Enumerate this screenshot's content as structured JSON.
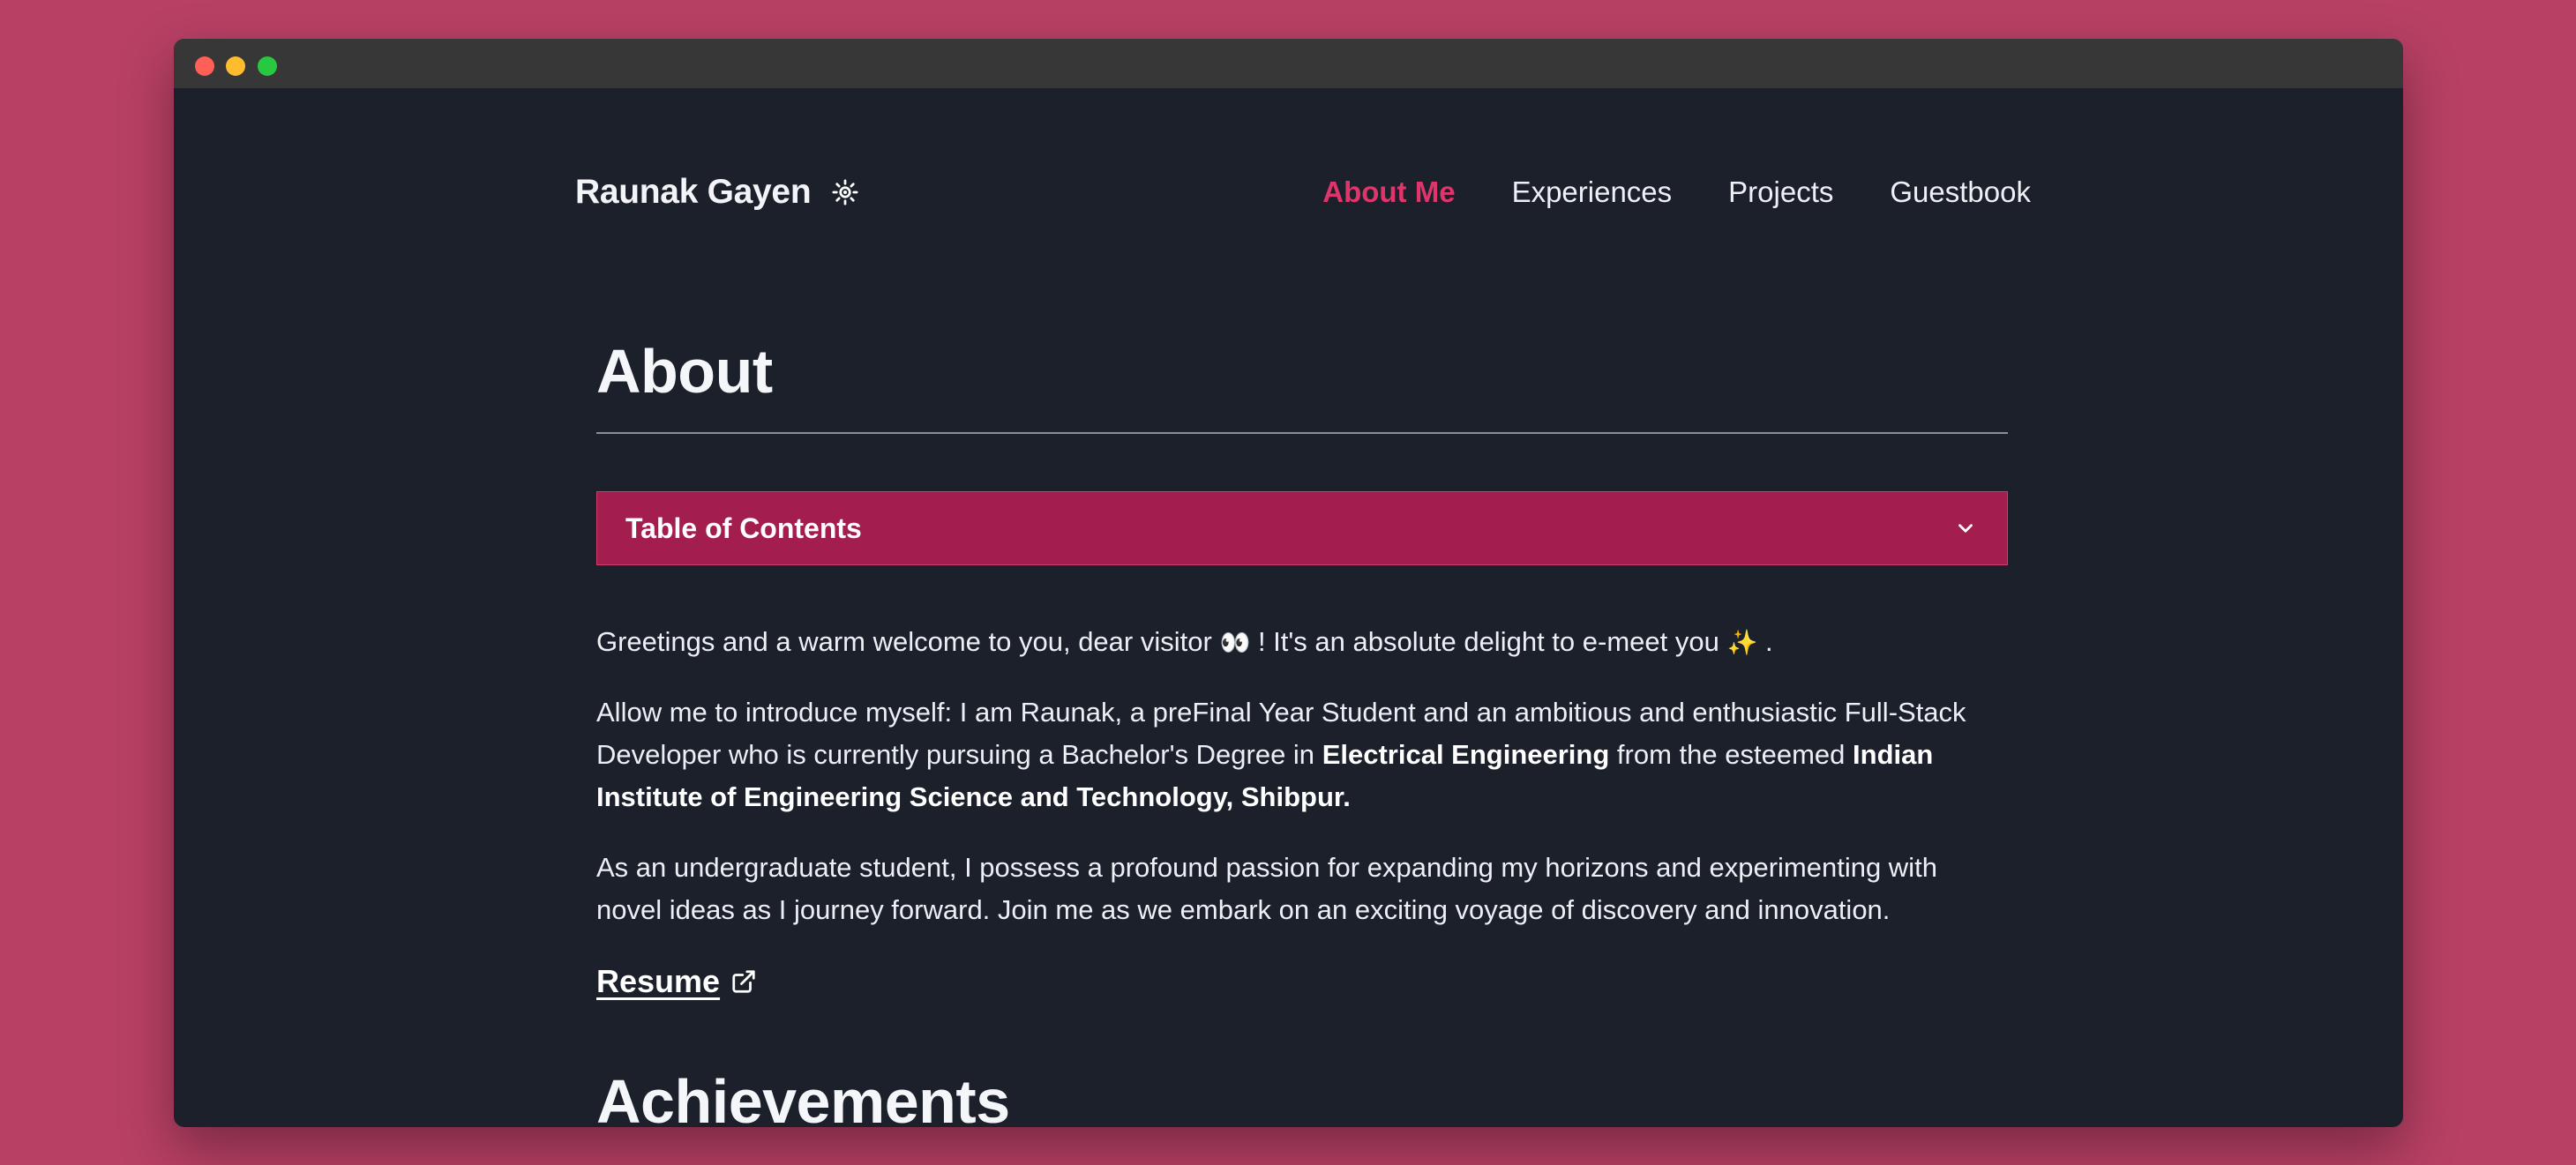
{
  "header": {
    "brand": "Raunak Gayen",
    "theme_icon": "sun-icon"
  },
  "nav": {
    "items": [
      {
        "label": "About Me",
        "active": true
      },
      {
        "label": "Experiences",
        "active": false
      },
      {
        "label": "Projects",
        "active": false
      },
      {
        "label": "Guestbook",
        "active": false
      }
    ]
  },
  "main": {
    "title": "About",
    "toc_label": "Table of Contents",
    "greeting": {
      "text_a": "Greetings and a warm welcome to you, dear visitor",
      "emoji_a": "👀",
      "text_b": "! It's an absolute delight to e-meet you",
      "emoji_b": "✨",
      "text_c": "."
    },
    "intro": {
      "text_a": "Allow me to introduce myself: I am Raunak, a preFinal Year Student and an ambitious and enthusiastic Full-Stack Developer who is currently pursuing a Bachelor's Degree in",
      "bold_degree": "Electrical Engineering",
      "text_b": "from the esteemed",
      "bold_institute": "Indian Institute of Engineering Science and Technology, Shibpur."
    },
    "passion": "As an undergraduate student, I possess a profound passion for expanding my horizons and experimenting with novel ideas as I journey forward. Join me as we embark on an exciting voyage of discovery and innovation.",
    "resume_label": "Resume",
    "achievements_title": "Achievements"
  },
  "colors": {
    "page_background": "#b84065",
    "window_background": "#1b202b",
    "accent": "#e0356a",
    "toc_background": "#a31e4f"
  }
}
